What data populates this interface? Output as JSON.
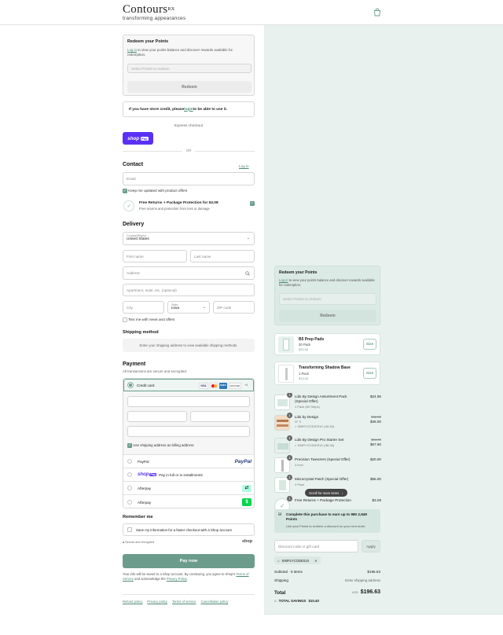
{
  "brand": {
    "name": "Contours",
    "mark": "RX",
    "tagline": "transforming appearances"
  },
  "colors": {
    "accent": "#6b9c8c",
    "shop_purple": "#5a31f4",
    "summary_bg": "#e8f1ee"
  },
  "redeem": {
    "title": "Redeem your Points",
    "login": "Log in",
    "desc": " to view your points balance and discover rewards available for redemption.",
    "select_placeholder": "Select Points to redeem",
    "button": "Redeem"
  },
  "store_credit": {
    "prefix": "If you have store credit, please ",
    "link": "login",
    "suffix": " to be able to use it."
  },
  "express": {
    "title": "Express checkout",
    "shop_pay": "shop",
    "shop_pay_badge": "Pay",
    "or": "OR"
  },
  "contact": {
    "title": "Contact",
    "login": "Log in",
    "email_placeholder": "Email",
    "updates_label": "Keep me updated with product offers",
    "protection_title": "Free Returns + Package Protection for $3.08",
    "protection_sub": "Free returns and protection from loss or damage"
  },
  "delivery": {
    "title": "Delivery",
    "country_label": "Country/Region",
    "country_value": "United States",
    "first_name": "First name",
    "last_name": "Last name",
    "address": "Address",
    "apartment": "Apartment, suite, etc. (optional)",
    "city": "City",
    "state_label": "State",
    "state_value": "Iowa",
    "zip": "ZIP code",
    "text_offers": "Text me with news and offers"
  },
  "shipping": {
    "title": "Shipping method",
    "note": "Enter your shipping address to view available shipping methods."
  },
  "payment": {
    "title": "Payment",
    "secure": "All transactions are secure and encrypted.",
    "credit_card": "Credit card",
    "cards": [
      "VISA",
      "MC",
      "AMEX",
      "DISCOVER",
      "+4"
    ],
    "billing_same": "Use shipping address as billing address",
    "paypal": "PayPal",
    "paypal_logo": "PayPal",
    "shoppay": "shop",
    "shoppay_badge": "Pay",
    "shoppay_text": "Pay in full or in installments",
    "afterpay1": "Afterpay",
    "afterpay2": "Afterpay"
  },
  "remember": {
    "title": "Remember me",
    "save_label": "Save my information for a faster checkout with a Shop account",
    "secure": "Secure and encrypted",
    "shop": "shop"
  },
  "pay_now": "Pay now",
  "legal": {
    "text": "Your info will be saved to a Shop account. By continuing, you agree to Shop's ",
    "terms": "Terms of Service",
    "mid": " and acknowledge the ",
    "privacy": "Privacy Policy",
    "end": "."
  },
  "footer": [
    "Refund policy",
    "Privacy policy",
    "Terms of service",
    "Cancellation policy"
  ],
  "summary": {
    "redeem_title": "Redeem your Points",
    "redeem_login": "Log in",
    "redeem_desc": " to view your points balance and discover rewards available for redemption.",
    "redeem_placeholder": "Select Points to redeem",
    "redeem_button": "Redeem",
    "upsells": [
      {
        "name": "B5 Prep Pads",
        "variant": "30 Pack",
        "price": "$20.00",
        "button": "Size"
      },
      {
        "name": "Transforming Shadow Base",
        "variant": "1 Pack",
        "price": "$13.00",
        "button": "Size"
      }
    ],
    "items": [
      {
        "qty": "1",
        "name": "Lids By Design Assortment Pack (Special Offer)",
        "variant": "1 Pack (60 Strips)",
        "price": "$24.95",
        "old": "",
        "code": ""
      },
      {
        "qty": "1",
        "name": "Lids by Design",
        "variant": "N° 3",
        "price": "$36.00",
        "old": "$42.50",
        "code": "SIMPLYCODES10 (-$4.50)"
      },
      {
        "qty": "1",
        "name": "Lids By Design Pro Starter Set",
        "variant": "",
        "price": "$57.60",
        "old": "$64.00",
        "code": "SIMPLYCODES10 (-$6.40)"
      },
      {
        "qty": "1",
        "name": "Precision Tweezers (Special Offer)",
        "variant": "3 inch",
        "price": "$20.00",
        "old": "",
        "code": ""
      },
      {
        "qty": "1",
        "name": "Microcrystal Patch (Special Offer)",
        "variant": "4 Pack",
        "price": "$55.00",
        "old": "",
        "code": ""
      },
      {
        "qty": "1",
        "name": "Free Returns + Package Protection",
        "variant": "",
        "price": "$3.08",
        "old": "",
        "code": ""
      }
    ],
    "scroll_more": "Scroll for more items",
    "points_title": "Complete this purchase to earn up to 980 2,949 Points",
    "points_sub": "Use your Points to redeem a discount on your next order.",
    "discount_placeholder": "Discount code or gift card",
    "apply": "Apply",
    "code_chip": "SIMPLYCODES10",
    "subtotal_label": "Subtotal · 6 items",
    "subtotal_value": "$196.63",
    "shipping_label": "Shipping",
    "shipping_value": "Enter shipping address",
    "total_label": "Total",
    "currency": "USD",
    "total_value": "$196.63",
    "savings_label": "TOTAL SAVINGS",
    "savings_value": "$10.40"
  }
}
